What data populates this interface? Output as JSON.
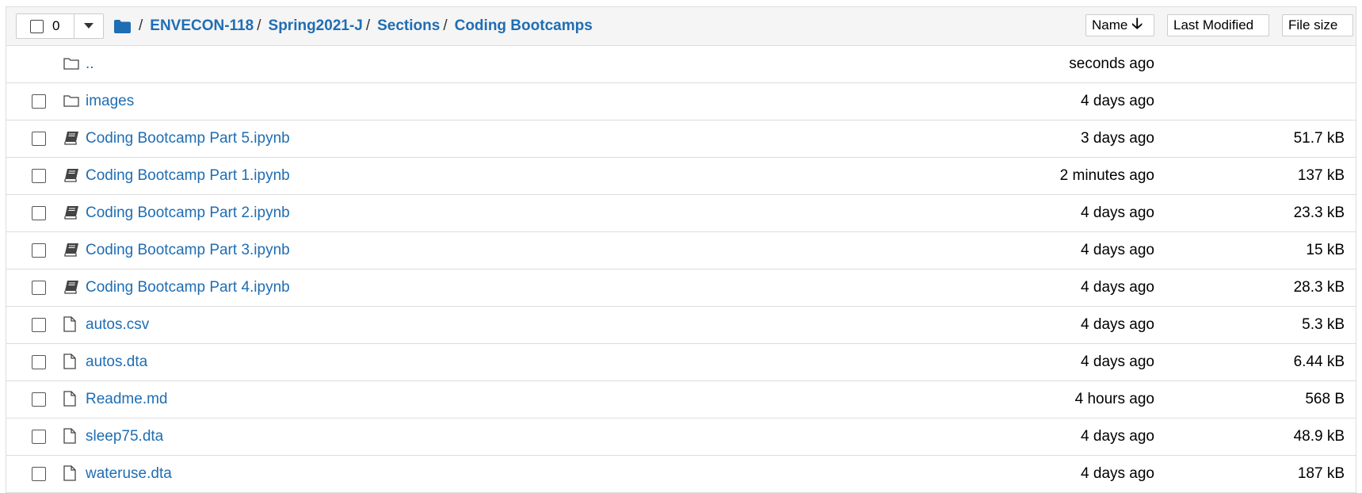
{
  "header": {
    "selected_count": "0",
    "breadcrumb": [
      "ENVECON-118",
      "Spring2021-J",
      "Sections",
      "Coding Bootcamps"
    ],
    "separator": "/",
    "sort_buttons": {
      "name": "Name",
      "name_arrow": "🡣",
      "modified": "Last Modified",
      "size": "File size"
    }
  },
  "rows": [
    {
      "type": "parent",
      "name": "..",
      "modified": "seconds ago",
      "size": ""
    },
    {
      "type": "folder",
      "name": "images",
      "modified": "4 days ago",
      "size": ""
    },
    {
      "type": "notebook",
      "name": "Coding Bootcamp Part 5.ipynb",
      "modified": "3 days ago",
      "size": "51.7 kB"
    },
    {
      "type": "notebook",
      "name": "Coding Bootcamp Part 1.ipynb",
      "modified": "2 minutes ago",
      "size": "137 kB"
    },
    {
      "type": "notebook",
      "name": "Coding Bootcamp Part 2.ipynb",
      "modified": "4 days ago",
      "size": "23.3 kB"
    },
    {
      "type": "notebook",
      "name": "Coding Bootcamp Part 3.ipynb",
      "modified": "4 days ago",
      "size": "15 kB"
    },
    {
      "type": "notebook",
      "name": "Coding Bootcamp Part 4.ipynb",
      "modified": "4 days ago",
      "size": "28.3 kB"
    },
    {
      "type": "file",
      "name": "autos.csv",
      "modified": "4 days ago",
      "size": "5.3 kB"
    },
    {
      "type": "file",
      "name": "autos.dta",
      "modified": "4 days ago",
      "size": "6.44 kB"
    },
    {
      "type": "file",
      "name": "Readme.md",
      "modified": "4 hours ago",
      "size": "568 B"
    },
    {
      "type": "file",
      "name": "sleep75.dta",
      "modified": "4 days ago",
      "size": "48.9 kB"
    },
    {
      "type": "file",
      "name": "wateruse.dta",
      "modified": "4 days ago",
      "size": "187 kB"
    }
  ],
  "colors": {
    "link": "#1f6db3",
    "header_bg": "#f5f5f5",
    "border": "#dddddd"
  }
}
